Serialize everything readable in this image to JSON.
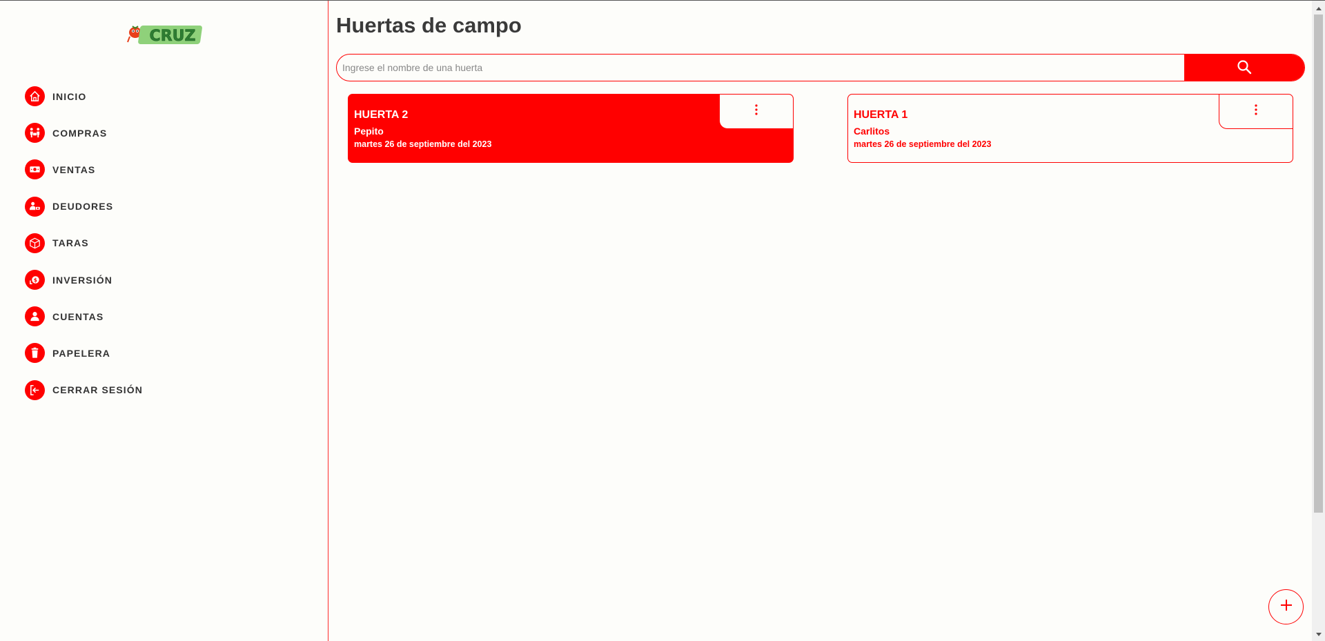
{
  "logo": {
    "text": "CRUZ"
  },
  "sidebar": {
    "items": [
      {
        "label": "INICIO",
        "icon": "home-icon"
      },
      {
        "label": "COMPRAS",
        "icon": "people-cart-icon"
      },
      {
        "label": "VENTAS",
        "icon": "money-icon"
      },
      {
        "label": "DEUDORES",
        "icon": "users-money-icon"
      },
      {
        "label": "TARAS",
        "icon": "box-icon"
      },
      {
        "label": "INVERSIÓN",
        "icon": "coin-hand-icon"
      },
      {
        "label": "CUENTAS",
        "icon": "user-icon"
      },
      {
        "label": "PAPELERA",
        "icon": "trash-icon"
      },
      {
        "label": "CERRAR SESIÓN",
        "icon": "logout-icon"
      }
    ]
  },
  "main": {
    "title": "Huertas de campo",
    "search": {
      "placeholder": "Ingrese el nombre de una huerta",
      "value": ""
    },
    "cards": [
      {
        "title": "HUERTA 2",
        "owner": "Pepito",
        "date": "martes 26 de septiembre del 2023",
        "style": "filled"
      },
      {
        "title": "HUERTA 1",
        "owner": "Carlitos",
        "date": "martes 26 de septiembre del 2023",
        "style": "outline"
      }
    ]
  },
  "colors": {
    "accent": "#ff0000",
    "background": "#fdfdfa",
    "text": "#3a3a3a",
    "logo_green": "#4caf50"
  }
}
